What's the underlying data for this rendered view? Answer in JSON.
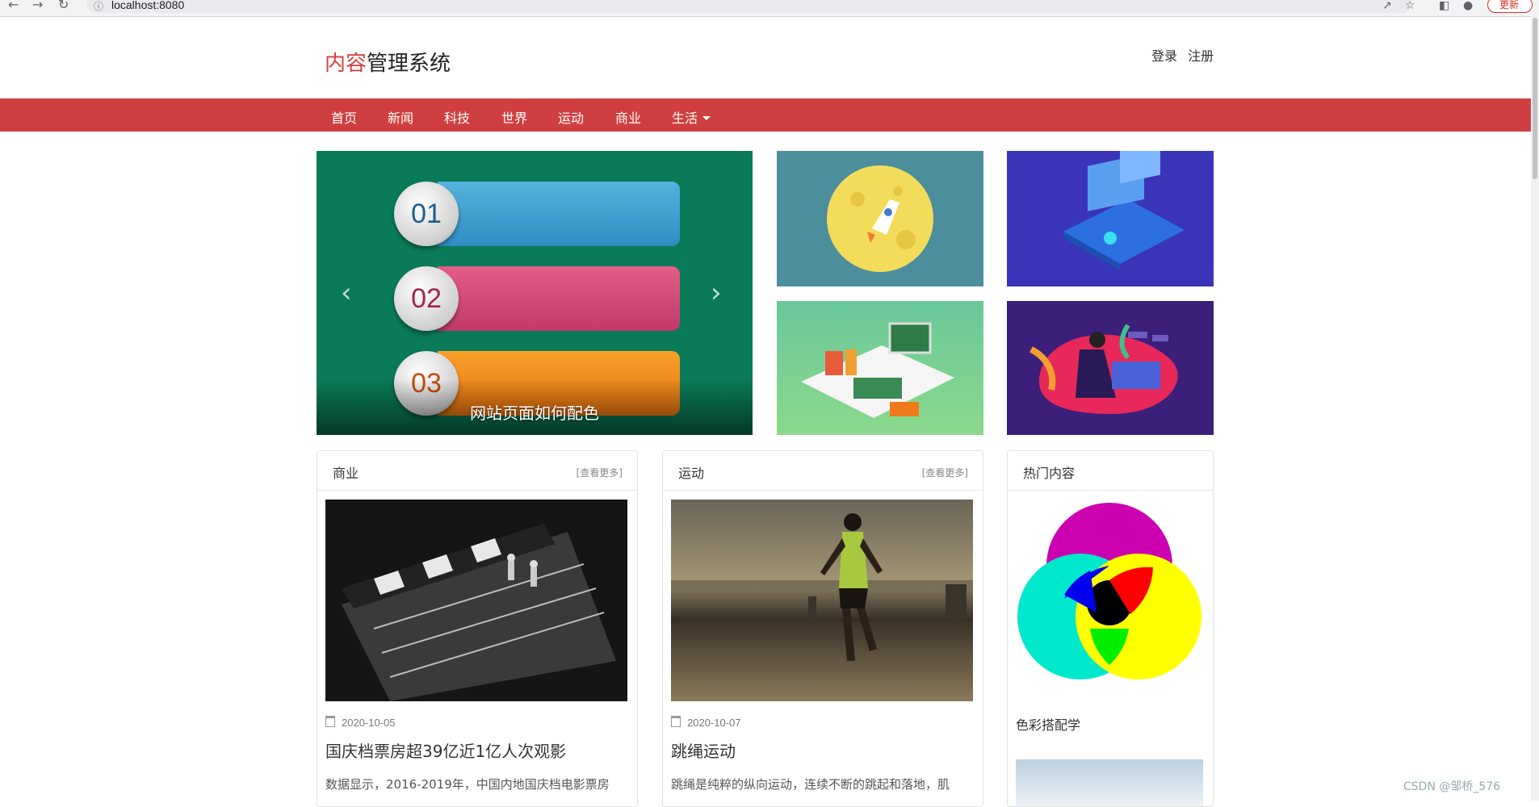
{
  "browser": {
    "url": "localhost:8080",
    "update_label": "更新"
  },
  "header": {
    "logo_red": "内容",
    "logo_dark": "管理系统",
    "login": "登录",
    "register": "注册"
  },
  "nav": {
    "items": [
      "首页",
      "新闻",
      "科技",
      "世界",
      "运动",
      "商业",
      "生活"
    ]
  },
  "carousel": {
    "numbers": [
      "01",
      "02",
      "03"
    ],
    "caption": "网站页面如何配色",
    "prev_icon": "chevron-left-icon",
    "next_icon": "chevron-right-icon"
  },
  "sections": [
    {
      "title": "商业",
      "more": "[查看更多]",
      "date": "2020-10-05",
      "article_title": "国庆档票房超39亿近1亿人次观影",
      "summary": "数据显示，2016-2019年，中国内地国庆档电影票房"
    },
    {
      "title": "运动",
      "more": "[查看更多]",
      "date": "2020-10-07",
      "article_title": "跳绳运动",
      "summary": "跳绳是纯粹的纵向运动，连续不断的跳起和落地，肌"
    }
  ],
  "hot": {
    "title": "热门内容",
    "items": [
      "色彩搭配学"
    ]
  },
  "watermark": "CSDN @邹桥_576"
}
